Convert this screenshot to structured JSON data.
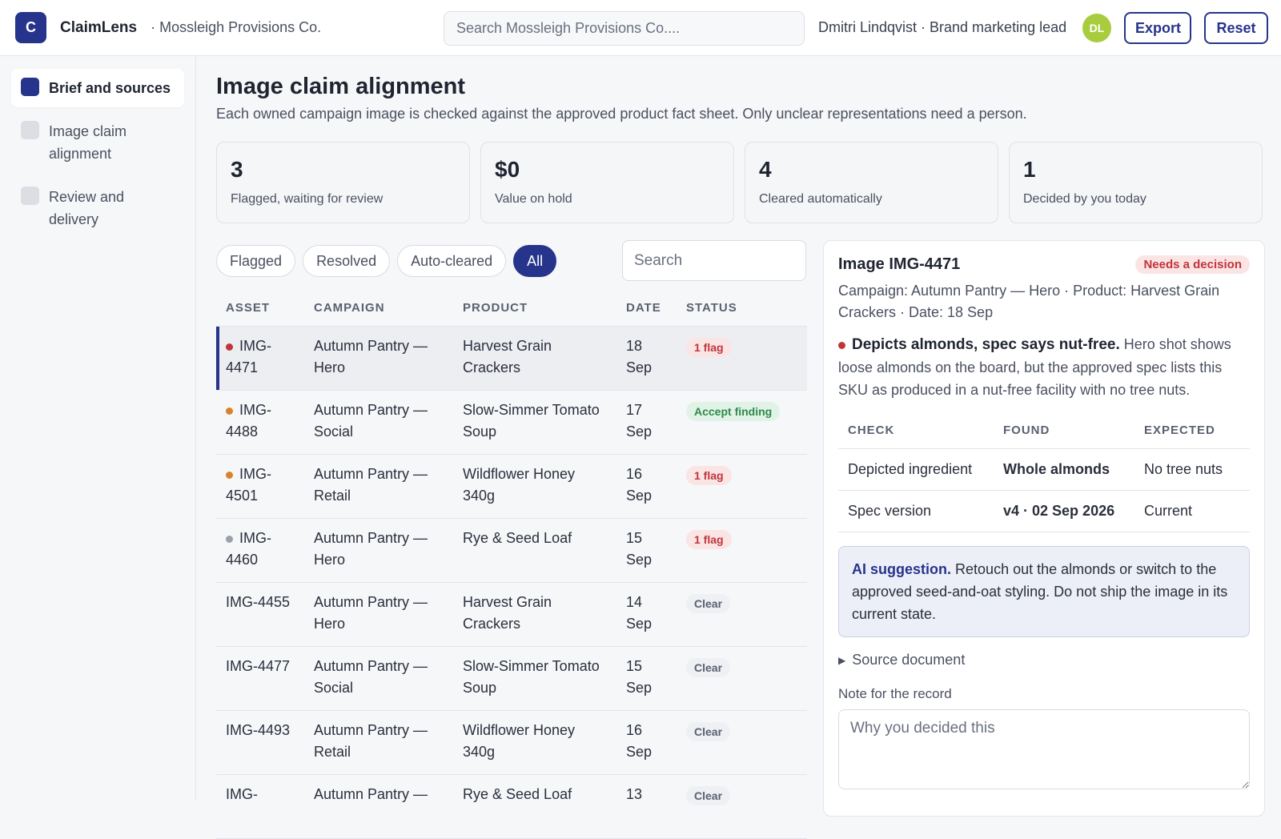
{
  "app": {
    "logo_letter": "C",
    "name": "ClaimLens",
    "org": "· Mossleigh Provisions Co."
  },
  "header": {
    "search_placeholder": "Search Mossleigh Provisions Co....",
    "user": "Dmitri Lindqvist · Brand marketing lead",
    "avatar_initials": "DL",
    "export_label": "Export",
    "reset_label": "Reset"
  },
  "sidebar": {
    "items": [
      {
        "label": "Brief and sources",
        "active": true
      },
      {
        "label": "Image claim alignment",
        "active": false
      },
      {
        "label": "Review and delivery",
        "active": false
      }
    ]
  },
  "main": {
    "title": "Image claim alignment",
    "subtitle": "Each owned campaign image is checked against the approved product fact sheet. Only unclear representations need a person."
  },
  "stats": [
    {
      "value": "3",
      "label": "Flagged, waiting for review"
    },
    {
      "value": "$0",
      "label": "Value on hold"
    },
    {
      "value": "4",
      "label": "Cleared automatically"
    },
    {
      "value": "1",
      "label": "Decided by you today"
    }
  ],
  "filters": [
    {
      "label": "Flagged",
      "active": false
    },
    {
      "label": "Resolved",
      "active": false
    },
    {
      "label": "Auto-cleared",
      "active": false
    },
    {
      "label": "All",
      "active": true
    }
  ],
  "table_search_placeholder": "Search",
  "table": {
    "headers": [
      "ASSET",
      "CAMPAIGN",
      "PRODUCT",
      "DATE",
      "STATUS"
    ],
    "rows": [
      {
        "asset": "IMG-4471",
        "dot": "#c0353b",
        "campaign": "Autumn Pantry — Hero",
        "product": "Harvest Grain Crackers",
        "date": "18 Sep",
        "status": "1 flag",
        "status_type": "flag",
        "selected": true
      },
      {
        "asset": "IMG-4488",
        "dot": "#d9822b",
        "campaign": "Autumn Pantry — Social",
        "product": "Slow-Simmer Tomato Soup",
        "date": "17 Sep",
        "status": "Accept finding",
        "status_type": "accept",
        "selected": false
      },
      {
        "asset": "IMG-4501",
        "dot": "#d9822b",
        "campaign": "Autumn Pantry — Retail",
        "product": "Wildflower Honey 340g",
        "date": "16 Sep",
        "status": "1 flag",
        "status_type": "flag",
        "selected": false
      },
      {
        "asset": "IMG-4460",
        "dot": "#9aa0ad",
        "campaign": "Autumn Pantry — Hero",
        "product": "Rye & Seed Loaf",
        "date": "15 Sep",
        "status": "1 flag",
        "status_type": "flag",
        "selected": false
      },
      {
        "asset": "IMG-4455",
        "dot": "",
        "campaign": "Autumn Pantry — Hero",
        "product": "Harvest Grain Crackers",
        "date": "14 Sep",
        "status": "Clear",
        "status_type": "clear",
        "selected": false
      },
      {
        "asset": "IMG-4477",
        "dot": "",
        "campaign": "Autumn Pantry — Social",
        "product": "Slow-Simmer Tomato Soup",
        "date": "15 Sep",
        "status": "Clear",
        "status_type": "clear",
        "selected": false
      },
      {
        "asset": "IMG-4493",
        "dot": "",
        "campaign": "Autumn Pantry — Retail",
        "product": "Wildflower Honey 340g",
        "date": "16 Sep",
        "status": "Clear",
        "status_type": "clear",
        "selected": false
      },
      {
        "asset": "IMG-",
        "dot": "",
        "campaign": "Autumn Pantry —",
        "product": "Rye & Seed Loaf",
        "date": "13",
        "status": "Clear",
        "status_type": "clear",
        "selected": false
      }
    ]
  },
  "detail": {
    "title": "Image IMG-4471",
    "badge": "Needs a decision",
    "meta": "Campaign: Autumn Pantry — Hero · Product: Harvest Grain Crackers · Date: 18 Sep",
    "finding_title": "Depicts almonds, spec says nut-free.",
    "finding_text": "Hero shot shows loose almonds on the board, but the approved spec lists this SKU as produced in a nut-free facility with no tree nuts.",
    "checks_headers": [
      "CHECK",
      "FOUND",
      "EXPECTED"
    ],
    "checks": [
      {
        "check": "Depicted ingredient",
        "found": "Whole almonds",
        "found_type": "bad",
        "expected": "No tree nuts"
      },
      {
        "check": "Spec version",
        "found": "v4 · 02 Sep 2026",
        "found_type": "good",
        "expected": "Current"
      }
    ],
    "ai_label": "AI suggestion.",
    "ai_text": "Retouch out the almonds or switch to the approved seed-and-oat styling. Do not ship the image in its current state.",
    "source_label": "Source document",
    "note_label": "Note for the record",
    "note_placeholder": "Why you decided this"
  },
  "colors": {
    "accent": "#27348b",
    "flag": "#c0353b",
    "ok": "#2f8a4a",
    "avatar": "#a9cc3e"
  }
}
